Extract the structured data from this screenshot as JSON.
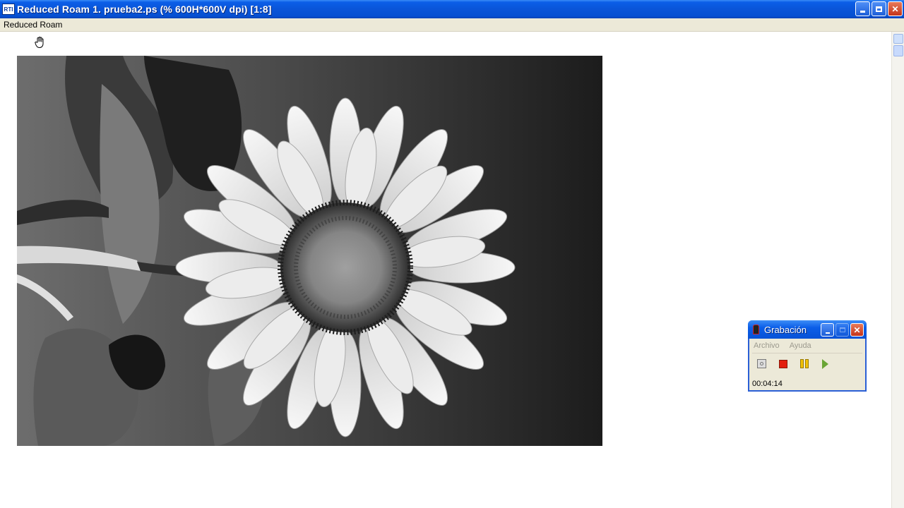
{
  "window": {
    "app_icon_text": "RTI",
    "title": "Reduced Roam 1. prueba2.ps (% 600H*600V dpi)  [1:8]"
  },
  "menu": {
    "items": [
      "Reduced Roam"
    ]
  },
  "viewer": {
    "cursor": "hand-pan-icon",
    "image": "grayscale-sunflower-photo"
  },
  "recorder": {
    "title": "Grabación",
    "menu": [
      "Archivo",
      "Ayuda"
    ],
    "toolbar": [
      "record-icon",
      "stop-icon",
      "pause-icon",
      "play-icon"
    ],
    "elapsed": "00:04:14"
  },
  "colors": {
    "titlebar": "#0a55d8",
    "menubar": "#ece9d8",
    "close_button": "#c4341a",
    "stop": "#e3200f",
    "pause": "#f2c200",
    "play": "#6aa535"
  }
}
